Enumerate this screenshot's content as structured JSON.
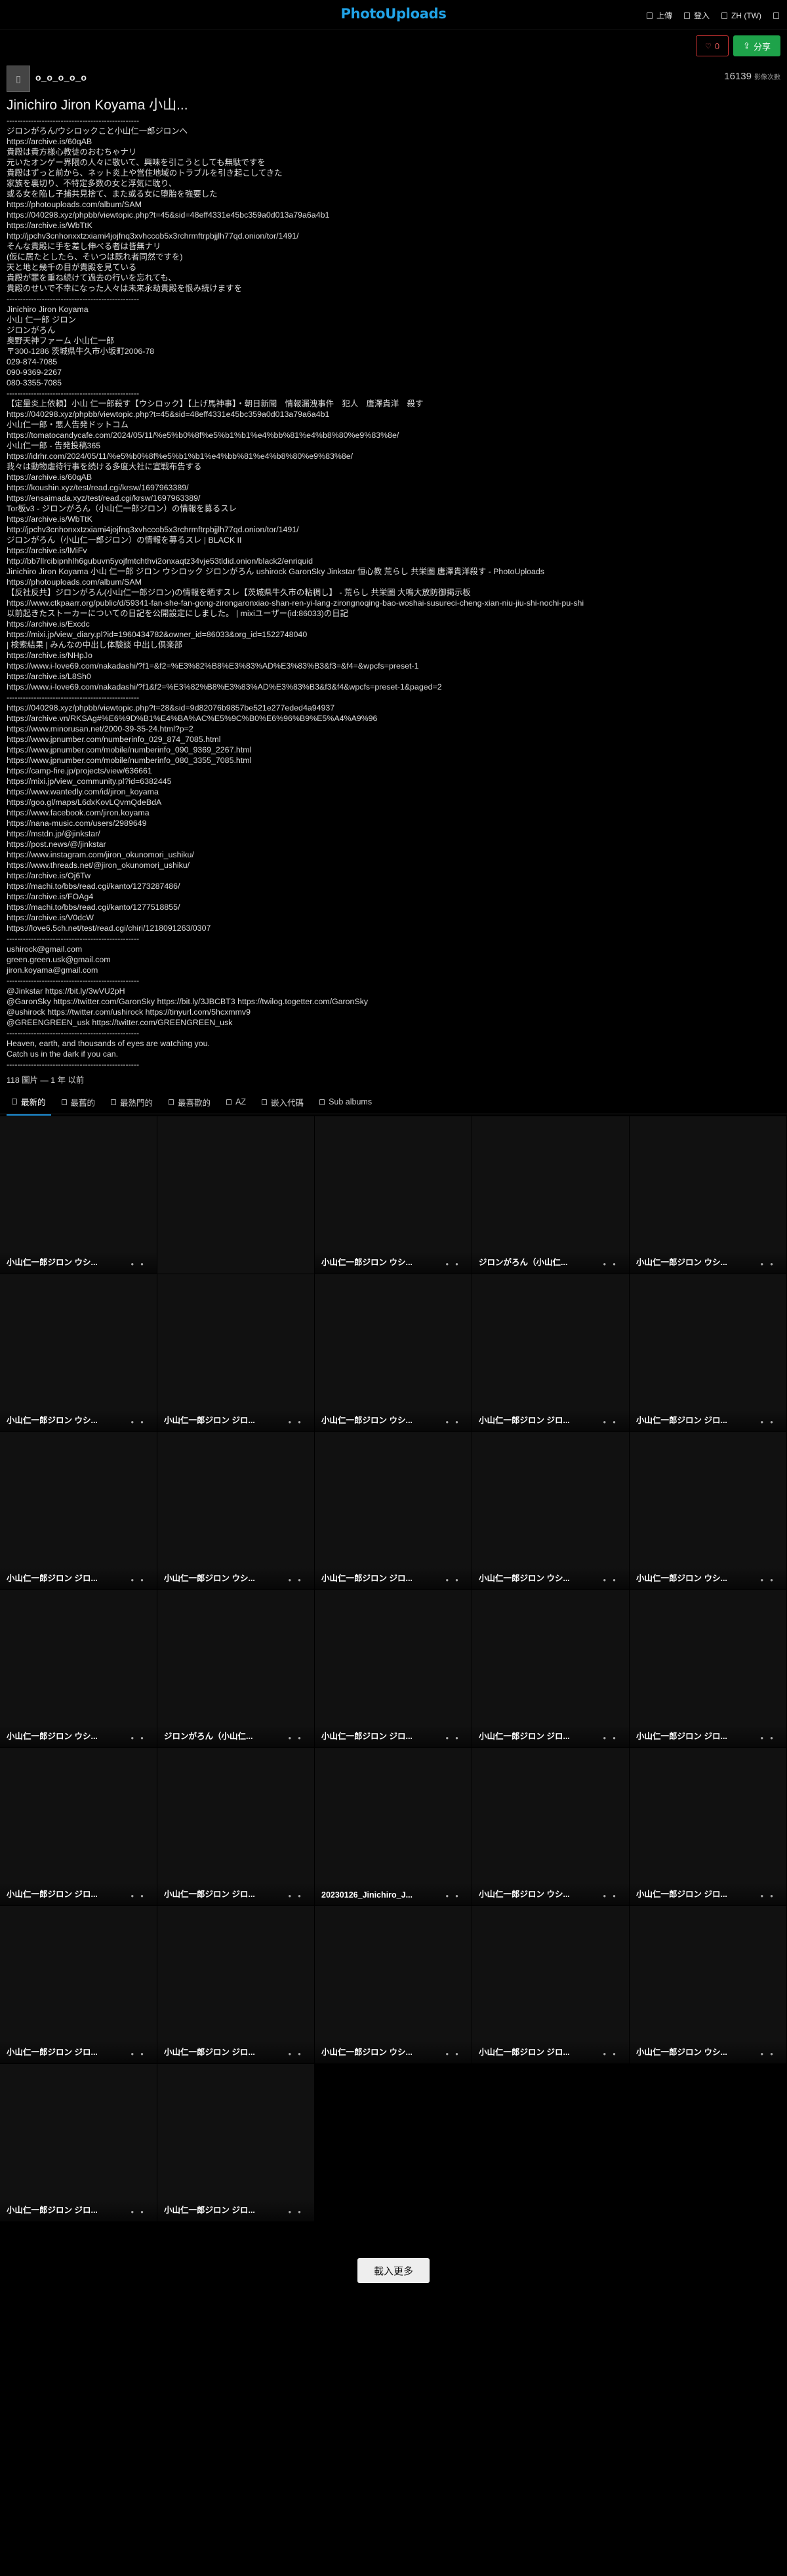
{
  "app": {
    "logo": "PhotoUploads",
    "nav": [
      {
        "icon": "upload-icon",
        "label": "上傳"
      },
      {
        "icon": "login-icon",
        "label": "登入"
      },
      {
        "icon": "language-icon",
        "label": "ZH (TW)"
      },
      {
        "icon": "menu-icon",
        "label": ""
      }
    ]
  },
  "actions": {
    "like_count": "0",
    "share_label": "分享"
  },
  "owner": {
    "name": "o_o_o_o_o",
    "views": "16139",
    "views_label": "影像次數"
  },
  "album": {
    "title": "Jinichiro Jiron Koyama 小山...",
    "description": [
      "-------------------------------------------------",
      "ジロンがろん/ウシロックこと小山仁一郎ジロンへ",
      "https://archive.is/60qAB",
      "貴殿は貴方様心教徒のおむちゃナリ",
      "元いたオンゲー界隈の人々に敬いて、興味を引こうとしても無駄ですを",
      "貴殿はずっと前から、ネット炎上や営住地域のトラブルを引き起こしてきた",
      "家族を裏切り、不特定多数の女と浮気に耽り、",
      "或る女を陥し子捕共見捨て、また或る女に堕胎を強要した",
      "https://photouploads.com/album/SAM",
      "https://040298.xyz/phpbb/viewtopic.php?t=45&sid=48eff4331e45bc359a0d013a79a6a4b1",
      "https://archive.is/WbTtK",
      "http://jpchv3cnhonxxtzxiami4jojfnq3xvhccob5x3rchrmftrpbjjlh77qd.onion/tor/1491/",
      "そんな貴殿に手を差し伸べる者は皆無ナリ",
      "(仮に居たとしたら、そいつは既れ者同然ですを)",
      "天と地と幾千の目が貴殿を見ている",
      "貴殿が罪を重ね続けて過去の行いを忘れても、",
      "貴殿のせいで不幸になった人々は未来永劫貴殿を恨み続けますを",
      "-------------------------------------------------",
      "Jinichiro Jiron Koyama",
      "小山 仁一郎 ジロン",
      "ジロンがろん",
      "奥野天神ファーム 小山仁一郎",
      "〒300-1286 茨城県牛久市小坂町2006-78",
      "029-874-7085",
      "090-9369-2267",
      "080-3355-7085",
      "-------------------------------------------------",
      "【定量炎上依頼】小山 仁一郎殺す【ウシロック】【上げ馬神事】・朝日新聞　情報漏洩事件　犯人　唐澤貴洋　殺す",
      "https://040298.xyz/phpbb/viewtopic.php?t=45&sid=48eff4331e45bc359a0d013a79a6a4b1",
      "小山仁一郎・悪人告発ドットコム",
      "https://tomatocandycafe.com/2024/05/11/%e5%b0%8f%e5%b1%b1%e4%bb%81%e4%b8%80%e9%83%8e/",
      "小山仁一郎 - 告発投稿365",
      "https://idrhr.com/2024/05/11/%e5%b0%8f%e5%b1%b1%e4%bb%81%e4%b8%80%e9%83%8e/",
      "我々は動物虐待行事を続ける多度大社に宣戦布告する",
      "https://archive.is/60qAB",
      "https://koushin.xyz/test/read.cgi/krsw/1697963389/",
      "https://ensaimada.xyz/test/read.cgi/krsw/1697963389/",
      "Tor板v3 - ジロンがろん（小山仁一郎ジロン）の情報を募るスレ",
      "https://archive.is/WbTtK",
      "http://jpchv3cnhonxxtzxiami4jojfnq3xvhccob5x3rchrmftrpbjjlh77qd.onion/tor/1491/",
      "ジロンがろん（小山仁一郎ジロン）の情報を募るスレ | BLACK II",
      "https://archive.is/lMiFv",
      "http://bb7llrcibipnhlh6gubuvn5yojfmtchthvi2onxaqtz34vje53tldid.onion/black2/enriquid",
      "Jinichiro Jiron Koyama 小山 仁一郎 ジロン ウシロック ジロンがろん ushirock GaronSky Jinkstar 恒心教 荒らし 共栄圏 唐澤貴洋殺す - PhotoUploads",
      "https://photouploads.com/album/SAM",
      "【反社反共】ジロンがろん(小山仁一郎ジロン)の情報を晒すスレ【茨城県牛久市の粘稠し】 - 荒らし 共栄圏 大鳴大放防御掲示板",
      "https://www.ctkpaarr.org/public/d/59341-fan-she-fan-gong-zirongaronxiao-shan-ren-yi-lang-zirongnoqing-bao-woshai-susureci-cheng-xian-niu-jiu-shi-nochi-pu-shi",
      "以前起きたストーカーについての日記を公開設定にしました。 | mixiユーザー(id:86033)の日記",
      "https://archive.is/Excdc",
      "https://mixi.jp/view_diary.pl?id=1960434782&owner_id=86033&org_id=1522748040",
      "| 検索結果 | みんなの中出し体験談 中出し倶楽部",
      "https://archive.is/NHpJo",
      "https://www.i-love69.com/nakadashi/?f1=&f2=%E3%82%B8%E3%83%AD%E3%83%B3&f3=&f4=&wpcfs=preset-1",
      "https://archive.is/L8Sh0",
      "https://www.i-love69.com/nakadashi/?f1&f2=%E3%82%B8%E3%83%AD%E3%83%B3&f3&f4&wpcfs=preset-1&paged=2",
      "-------------------------------------------------",
      "https://040298.xyz/phpbb/viewtopic.php?t=28&sid=9d82076b9857be521e277eded4a94937",
      "https://archive.vn/RKSAg#%E6%9D%B1%E4%BA%AC%E5%9C%B0%E6%96%B9%E5%A4%A9%96",
      "https://www.minorusan.net/2000-39-35-24.html?p=2",
      "https://www.jpnumber.com/numberinfo_029_874_7085.html",
      "https://www.jpnumber.com/mobile/numberinfo_090_9369_2267.html",
      "https://www.jpnumber.com/mobile/numberinfo_080_3355_7085.html",
      "https://camp-fire.jp/projects/view/636661",
      "https://mixi.jp/view_community.pl?id=6382445",
      "https://www.wantedly.com/id/jiron_koyama",
      "https://goo.gl/maps/L6dxKovLQvmQdeBdA",
      "https://www.facebook.com/jiron.koyama",
      "https://nana-music.com/users/2989649",
      "https://mstdn.jp/@jinkstar/",
      "https://post.news/@/jinkstar",
      "https://www.instagram.com/jiron_okunomori_ushiku/",
      "https://www.threads.net/@jiron_okunomori_ushiku/",
      "https://archive.is/Oj6Tw",
      "https://machi.to/bbs/read.cgi/kanto/1273287486/",
      "https://archive.is/FOAg4",
      "https://machi.to/bbs/read.cgi/kanto/1277518855/",
      "https://archive.is/V0dcW",
      "https://love6.5ch.net/test/read.cgi/chiri/1218091263/0307",
      "-------------------------------------------------",
      "ushirock@gmail.com",
      "green.green.usk@gmail.com",
      "jiron.koyama@gmail.com",
      "-------------------------------------------------",
      "@Jinkstar https://bit.ly/3wVU2pH",
      "@GaronSky https://twitter.com/GaronSky https://bit.ly/3JBCBT3 https://twilog.togetter.com/GaronSky",
      "@ushirock https://twitter.com/ushirock https://tinyurl.com/5hcxmmv9",
      "@GREENGREEN_usk https://twitter.com/GREENGREEN_usk",
      "-------------------------------------------------",
      "Heaven, earth, and thousands of eyes are watching you.",
      "Catch us in the dark if you can.",
      "-------------------------------------------------"
    ],
    "meta": "118 圖片 — 1 年 以前"
  },
  "tabs": [
    {
      "icon": "sort-icon",
      "label": "最新的"
    },
    {
      "icon": "sort-icon",
      "label": "最舊的"
    },
    {
      "icon": "sort-icon",
      "label": "最熱門的"
    },
    {
      "icon": "sort-icon",
      "label": "最喜歡的"
    },
    {
      "icon": "sort-icon",
      "label": "AZ"
    },
    {
      "icon": "embed-icon",
      "label": "嵌入代碼"
    },
    {
      "icon": "folder-icon",
      "label": "Sub albums"
    }
  ],
  "grid": [
    "小山仁一郎ジロン ウシ...",
    "",
    "小山仁一郎ジロン ウシ...",
    "ジロンがろん（小山仁...",
    "小山仁一郎ジロン ウシ...",
    "小山仁一郎ジロン ウシ...",
    "小山仁一郎ジロン ジロ...",
    "小山仁一郎ジロン ウシ...",
    "小山仁一郎ジロン ジロ...",
    "小山仁一郎ジロン ジロ...",
    "小山仁一郎ジロン ジロ...",
    "小山仁一郎ジロン ウシ...",
    "小山仁一郎ジロン ジロ...",
    "小山仁一郎ジロン ウシ...",
    "小山仁一郎ジロン ウシ...",
    "小山仁一郎ジロン ウシ...",
    "ジロンがろん（小山仁...",
    "小山仁一郎ジロン ジロ...",
    "小山仁一郎ジロン ジロ...",
    "小山仁一郎ジロン ジロ...",
    "小山仁一郎ジロン ジロ...",
    "小山仁一郎ジロン ジロ...",
    "20230126_Jinichiro_J...",
    "小山仁一郎ジロン ウシ...",
    "小山仁一郎ジロン ジロ...",
    "小山仁一郎ジロン ジロ...",
    "小山仁一郎ジロン ジロ...",
    "小山仁一郎ジロン ウシ...",
    "小山仁一郎ジロン ジロ...",
    "小山仁一郎ジロン ウシ...",
    "小山仁一郎ジロン ジロ...",
    "小山仁一郎ジロン ジロ..."
  ],
  "load_more": "載入更多"
}
